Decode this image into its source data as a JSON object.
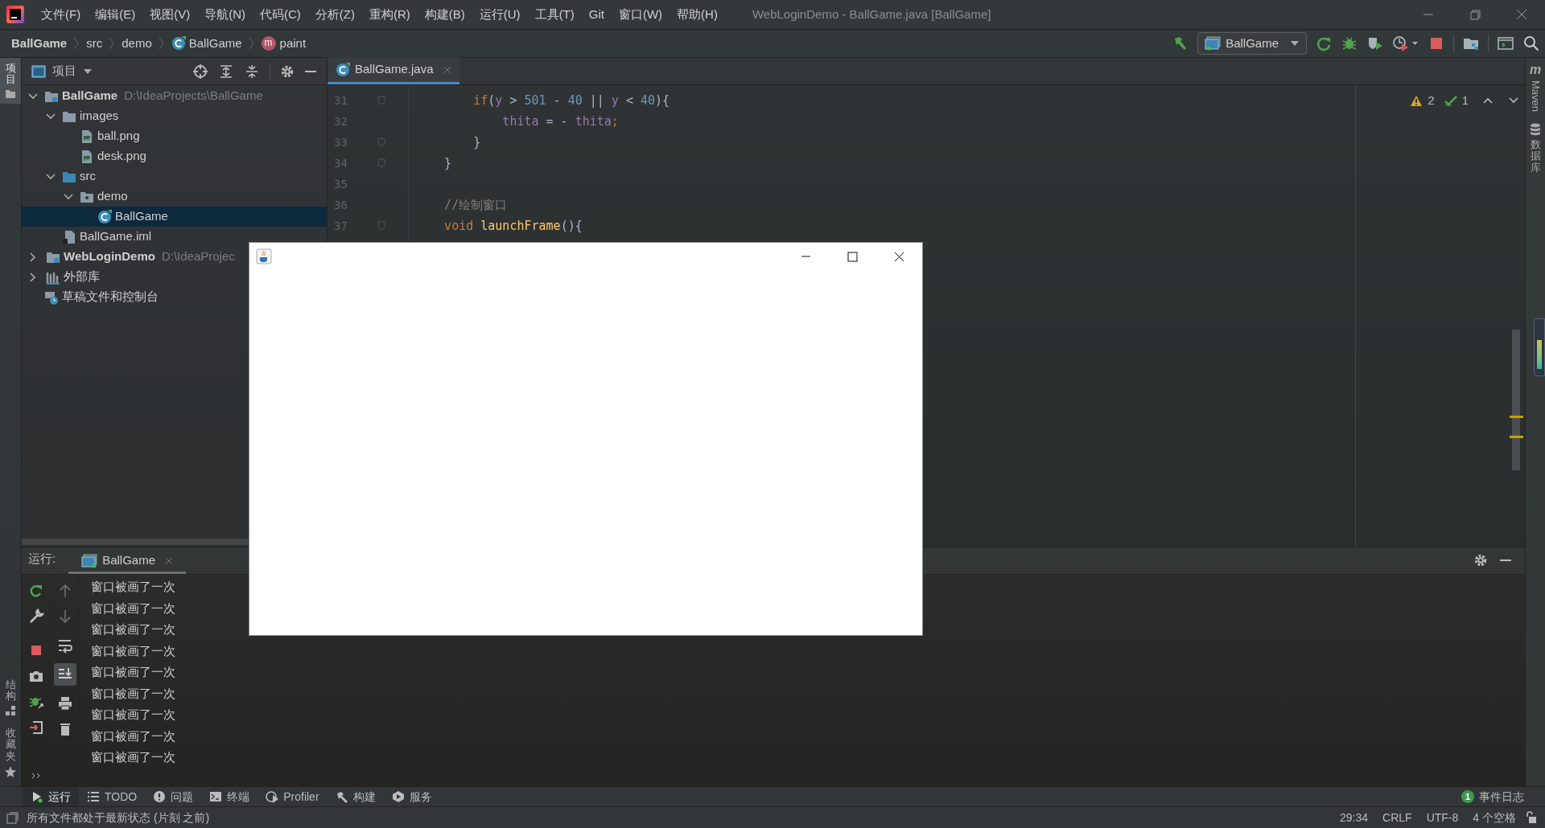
{
  "title_bar": {
    "menu": [
      "文件(F)",
      "编辑(E)",
      "视图(V)",
      "导航(N)",
      "代码(C)",
      "分析(Z)",
      "重构(R)",
      "构建(B)",
      "运行(U)",
      "工具(T)",
      "Git",
      "窗口(W)",
      "帮助(H)"
    ],
    "title": "WebLoginDemo - BallGame.java [BallGame]"
  },
  "breadcrumbs": [
    {
      "label": "BallGame",
      "kind": "project"
    },
    {
      "label": "src",
      "kind": "folder"
    },
    {
      "label": "demo",
      "kind": "folder"
    },
    {
      "label": "BallGame",
      "kind": "class"
    },
    {
      "label": "paint",
      "kind": "method",
      "icon_letter": "m"
    }
  ],
  "run_config": {
    "label": "BallGame"
  },
  "left_strip": {
    "top": [
      {
        "label": "项目",
        "selected": true
      }
    ],
    "bottom": [
      {
        "label": "结构",
        "kind": "structure"
      },
      {
        "label": "收藏夹",
        "kind": "favorites"
      }
    ]
  },
  "project_panel": {
    "title": "项目",
    "tree": [
      {
        "label": "BallGame",
        "kind": "module",
        "path": "D:\\IdeaProjects\\BallGame",
        "expanded": true,
        "selected": false,
        "children": [
          {
            "label": "images",
            "kind": "folder",
            "expanded": true,
            "selected": false,
            "children": [
              {
                "label": "ball.png",
                "kind": "image",
                "selected": false
              },
              {
                "label": "desk.png",
                "kind": "image",
                "selected": false
              }
            ]
          },
          {
            "label": "src",
            "kind": "source",
            "expanded": true,
            "selected": false,
            "children": [
              {
                "label": "demo",
                "kind": "package",
                "expanded": true,
                "selected": false,
                "children": [
                  {
                    "label": "BallGame",
                    "kind": "class",
                    "selected": true
                  }
                ]
              }
            ]
          },
          {
            "label": "BallGame.iml",
            "kind": "iml",
            "selected": false
          }
        ]
      },
      {
        "label": "WebLoginDemo",
        "kind": "module",
        "path": "D:\\IdeaProjec",
        "expanded": false,
        "selected": false
      },
      {
        "label": "外部库",
        "kind": "library",
        "expanded": false,
        "selected": false
      },
      {
        "label": "草稿文件和控制台",
        "kind": "scratch",
        "selected": false
      }
    ]
  },
  "editor": {
    "tabs": [
      {
        "label": "BallGame.java",
        "selected": true
      }
    ],
    "inspections": {
      "warnings": "2",
      "checks": "1"
    },
    "lines": [
      {
        "number": "31",
        "fold": true,
        "tokens": [
          {
            "text": "        if",
            "kind": "keyword"
          },
          {
            "text": "(",
            "kind": "plain"
          },
          {
            "text": "y",
            "kind": "field"
          },
          {
            "text": " > ",
            "kind": "plain"
          },
          {
            "text": "501",
            "kind": "number"
          },
          {
            "text": " - ",
            "kind": "plain"
          },
          {
            "text": "40",
            "kind": "number"
          },
          {
            "text": " || ",
            "kind": "plain"
          },
          {
            "text": "y",
            "kind": "field"
          },
          {
            "text": " < ",
            "kind": "plain"
          },
          {
            "text": "40",
            "kind": "number"
          },
          {
            "text": "){",
            "kind": "plain"
          }
        ]
      },
      {
        "number": "32",
        "fold": false,
        "tokens": [
          {
            "text": "            thita",
            "kind": "field"
          },
          {
            "text": " = - ",
            "kind": "plain"
          },
          {
            "text": "thita",
            "kind": "field"
          },
          {
            "text": ";",
            "kind": "keyword"
          }
        ]
      },
      {
        "number": "33",
        "fold": true,
        "tokens": [
          {
            "text": "        }",
            "kind": "plain"
          }
        ]
      },
      {
        "number": "34",
        "fold": true,
        "tokens": [
          {
            "text": "    }",
            "kind": "plain"
          }
        ]
      },
      {
        "number": "35",
        "fold": false
      },
      {
        "number": "36",
        "fold": false,
        "tokens": [
          {
            "text": "    //绘制窗口",
            "kind": "comment"
          }
        ]
      },
      {
        "number": "37",
        "fold": true,
        "tokens": [
          {
            "text": "    void ",
            "kind": "keyword"
          },
          {
            "text": "launchFrame",
            "kind": "method"
          },
          {
            "text": "(){",
            "kind": "plain"
          }
        ]
      }
    ]
  },
  "right_strip": [
    {
      "label": "Maven",
      "kind": "maven",
      "icon_letter": "m"
    },
    {
      "label": "数据库",
      "kind": "database"
    }
  ],
  "run_panel": {
    "label": "运行:",
    "tabs": [
      {
        "label": "BallGame",
        "selected": true
      }
    ],
    "console": [
      "窗口被画了一次",
      "窗口被画了一次",
      "窗口被画了一次",
      "窗口被画了一次",
      "窗口被画了一次",
      "窗口被画了一次",
      "窗口被画了一次",
      "窗口被画了一次",
      "窗口被画了一次"
    ]
  },
  "tool_bar": {
    "items": [
      {
        "label": "运行",
        "kind": "run",
        "selected": true
      },
      {
        "label": "TODO",
        "kind": "todo",
        "selected": false
      },
      {
        "label": "问题",
        "kind": "problems",
        "selected": false
      },
      {
        "label": "终端",
        "kind": "terminal",
        "selected": false
      },
      {
        "label": "Profiler",
        "kind": "profiler",
        "selected": false
      },
      {
        "label": "构建",
        "kind": "build",
        "selected": false
      },
      {
        "label": "服务",
        "kind": "services",
        "selected": false
      }
    ],
    "event_log": {
      "label": "事件日志",
      "count": "1"
    }
  },
  "status_bar": {
    "message": "所有文件都处于最新状态 (片刻 之前)",
    "items": [
      "29:34",
      "CRLF",
      "UTF-8",
      "4 个空格"
    ]
  }
}
